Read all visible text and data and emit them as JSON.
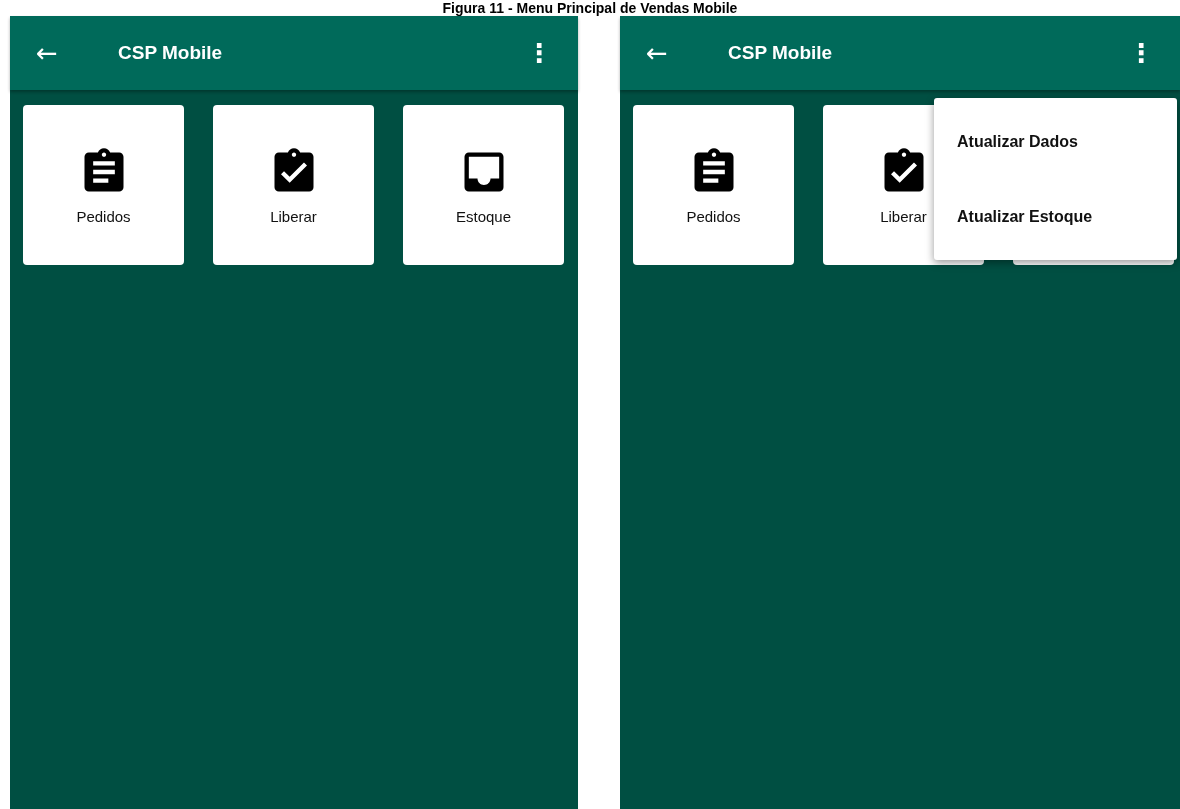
{
  "caption": "Figura 11 - Menu Principal de Vendas Mobile",
  "screens": [
    {
      "app_bar": {
        "back": "←",
        "title": "CSP Mobile",
        "more": "⋮"
      },
      "tiles": [
        {
          "kind": "list",
          "label": "Pedidos"
        },
        {
          "kind": "check",
          "label": "Liberar"
        },
        {
          "kind": "tray",
          "label": "Estoque"
        }
      ]
    },
    {
      "app_bar": {
        "back": "←",
        "title": "CSP Mobile",
        "more": "⋮"
      },
      "tiles": [
        {
          "kind": "list",
          "label": "Pedidos"
        },
        {
          "kind": "check",
          "label": "Liberar"
        },
        {
          "kind": "blank"
        }
      ],
      "menu": [
        "Atualizar Dados",
        "Atualizar Estoque"
      ]
    }
  ]
}
